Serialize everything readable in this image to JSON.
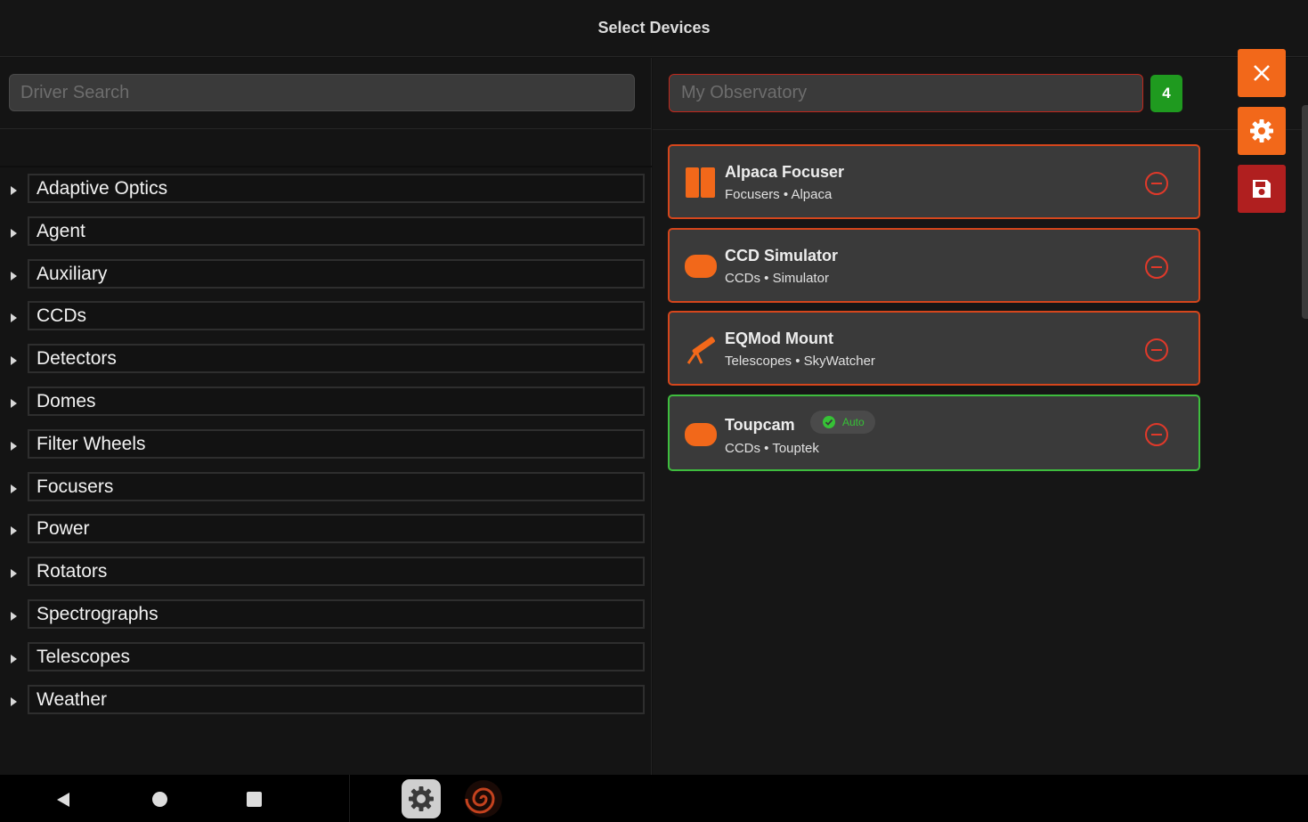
{
  "header": {
    "title": "Select Devices"
  },
  "driver_search": {
    "placeholder": "Driver Search"
  },
  "categories": [
    {
      "label": "Adaptive Optics"
    },
    {
      "label": "Agent"
    },
    {
      "label": "Auxiliary"
    },
    {
      "label": "CCDs"
    },
    {
      "label": "Detectors"
    },
    {
      "label": "Domes"
    },
    {
      "label": "Filter Wheels"
    },
    {
      "label": "Focusers"
    },
    {
      "label": "Power"
    },
    {
      "label": "Rotators"
    },
    {
      "label": "Spectrographs"
    },
    {
      "label": "Telescopes"
    },
    {
      "label": "Weather"
    }
  ],
  "profile": {
    "placeholder": "My Observatory",
    "device_count": "4"
  },
  "devices": [
    {
      "name": "Alpaca Focuser",
      "subtitle": "Focusers • Alpaca",
      "icon": "focuser-icon",
      "auto": false
    },
    {
      "name": "CCD Simulator",
      "subtitle": "CCDs • Simulator",
      "icon": "ccd-camera-icon",
      "auto": false
    },
    {
      "name": "EQMod Mount",
      "subtitle": "Telescopes • SkyWatcher",
      "icon": "telescope-icon",
      "auto": false
    },
    {
      "name": "Toupcam",
      "subtitle": "CCDs • Touptek",
      "icon": "ccd-camera-icon",
      "auto": true,
      "auto_label": "Auto"
    }
  ],
  "actions": [
    {
      "name": "close",
      "icon": "close-icon"
    },
    {
      "name": "settings",
      "icon": "gear-icon"
    },
    {
      "name": "save",
      "icon": "save-icon"
    }
  ],
  "colors": {
    "accent_orange": "#f2681a",
    "save_red": "#b01f1f",
    "auto_green": "#3ebd3e",
    "card_border": "#d5461c",
    "badge_green": "#1f9a1f"
  }
}
